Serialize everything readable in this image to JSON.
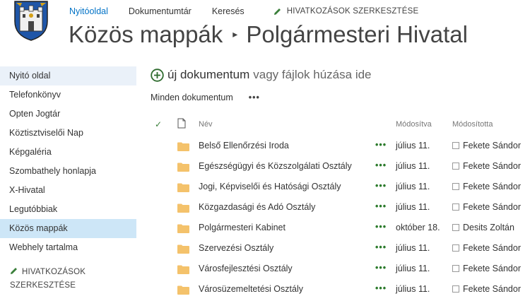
{
  "logo": {
    "alt": "city coat of arms"
  },
  "topnav": {
    "items": [
      {
        "label": "Nyitóoldal",
        "active": true
      },
      {
        "label": "Dokumentumtár",
        "active": false
      },
      {
        "label": "Keresés",
        "active": false
      }
    ],
    "edit_links_label": "HIVATKOZÁSOK SZERKESZTÉSE"
  },
  "breadcrumb": {
    "parent": "Közös mappák",
    "separator": "▸",
    "current": "Polgármesteri Hivatal"
  },
  "leftnav": {
    "items": [
      {
        "label": "Nyitó oldal"
      },
      {
        "label": "Telefonkönyv"
      },
      {
        "label": "Opten Jogtár"
      },
      {
        "label": "Köztisztviselői Nap"
      },
      {
        "label": "Képgaléria"
      },
      {
        "label": "Szombathely honlapja"
      },
      {
        "label": "X-Hivatal"
      },
      {
        "label": "Legutóbbiak"
      },
      {
        "label": "Közös mappák"
      },
      {
        "label": "Webhely tartalma"
      }
    ],
    "edit_links_line1": "HIVATKOZÁSOK",
    "edit_links_line2": "SZERKESZTÉSE"
  },
  "new_document": {
    "link_label": "új dokumentum",
    "drag_text": "vagy fájlok húzása ide"
  },
  "view": {
    "label": "Minden dokumentum",
    "ellipsis": "•••"
  },
  "table": {
    "headers": {
      "check": "✓",
      "name": "Név",
      "modified": "Módosítva",
      "modified_by": "Módosította"
    },
    "ellipsis": "•••",
    "rows": [
      {
        "name": "Belső Ellenőrzési Iroda",
        "modified": "július 11.",
        "modified_by": "Fekete Sándor"
      },
      {
        "name": "Egészségügyi és Közszolgálati Osztály",
        "modified": "július 11.",
        "modified_by": "Fekete Sándor"
      },
      {
        "name": "Jogi, Képviselői és Hatósági Osztály",
        "modified": "július 11.",
        "modified_by": "Fekete Sándor"
      },
      {
        "name": "Közgazdasági és Adó Osztály",
        "modified": "július 11.",
        "modified_by": "Fekete Sándor"
      },
      {
        "name": "Polgármesteri Kabinet",
        "modified": "október 18.",
        "modified_by": "Desits Zoltán"
      },
      {
        "name": "Szervezési Osztály",
        "modified": "július 11.",
        "modified_by": "Fekete Sándor"
      },
      {
        "name": "Városfejlesztési Osztály",
        "modified": "július 11.",
        "modified_by": "Fekete Sándor"
      },
      {
        "name": "Városüzemeltetési Osztály",
        "modified": "július 11.",
        "modified_by": "Fekete Sándor"
      }
    ]
  },
  "colors": {
    "accent": "#0072c6",
    "folder": "#f4c26b",
    "ellipsis_green": "#2b7a2b",
    "nav_selected": "#cde6f7"
  }
}
